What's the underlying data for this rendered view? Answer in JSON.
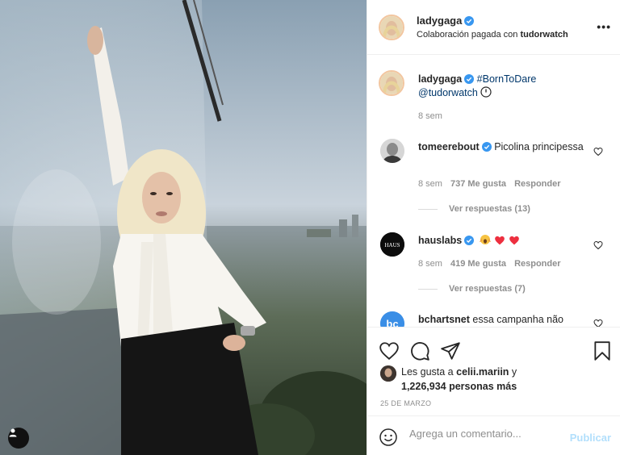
{
  "post": {
    "image_alt": "Woman in white blouse and black trousers posing beside a glass window overlooking a city",
    "author": "ladygaga",
    "subtitle_prefix": "Colaboración pagada con",
    "partner": "tudorwatch",
    "more_label": "•••"
  },
  "caption": {
    "user": "ladygaga",
    "hashtag": "#BornToDare",
    "mention": "@tudorwatch",
    "time": "8 sem"
  },
  "comments": [
    {
      "user": "tomeerebout",
      "text": "Picolina principessa",
      "time": "8 sem",
      "likes": "737 Me gusta",
      "reply": "Responder",
      "replies": "Ver respuestas (13)"
    },
    {
      "user": "hauslabs",
      "avatar_text": "HAUS",
      "text": "",
      "time": "8 sem",
      "likes": "419 Me gusta",
      "reply": "Responder",
      "replies": "Ver respuestas (7)"
    },
    {
      "user": "bchartsnet",
      "avatar_text": "bc",
      "text": "essa campanha não"
    }
  ],
  "likes": {
    "prefix": "Les gusta a",
    "user": "celii.mariin",
    "middle": "y",
    "count": "1,226,934 personas más"
  },
  "date": "25 DE MARZO",
  "composer": {
    "placeholder": "Agrega un comentario...",
    "publish": "Publicar"
  },
  "colors": {
    "verified": "#3897f0",
    "link": "#00376b",
    "publish_disabled": "#b2dffc",
    "heart": "#ed4956",
    "muted": "#8e8e8e"
  },
  "icons": [
    "user-tag-icon",
    "verified-icon",
    "clock-icon",
    "heart-icon",
    "comment-icon",
    "share-icon",
    "bookmark-icon",
    "emoji-icon",
    "more-icon"
  ]
}
